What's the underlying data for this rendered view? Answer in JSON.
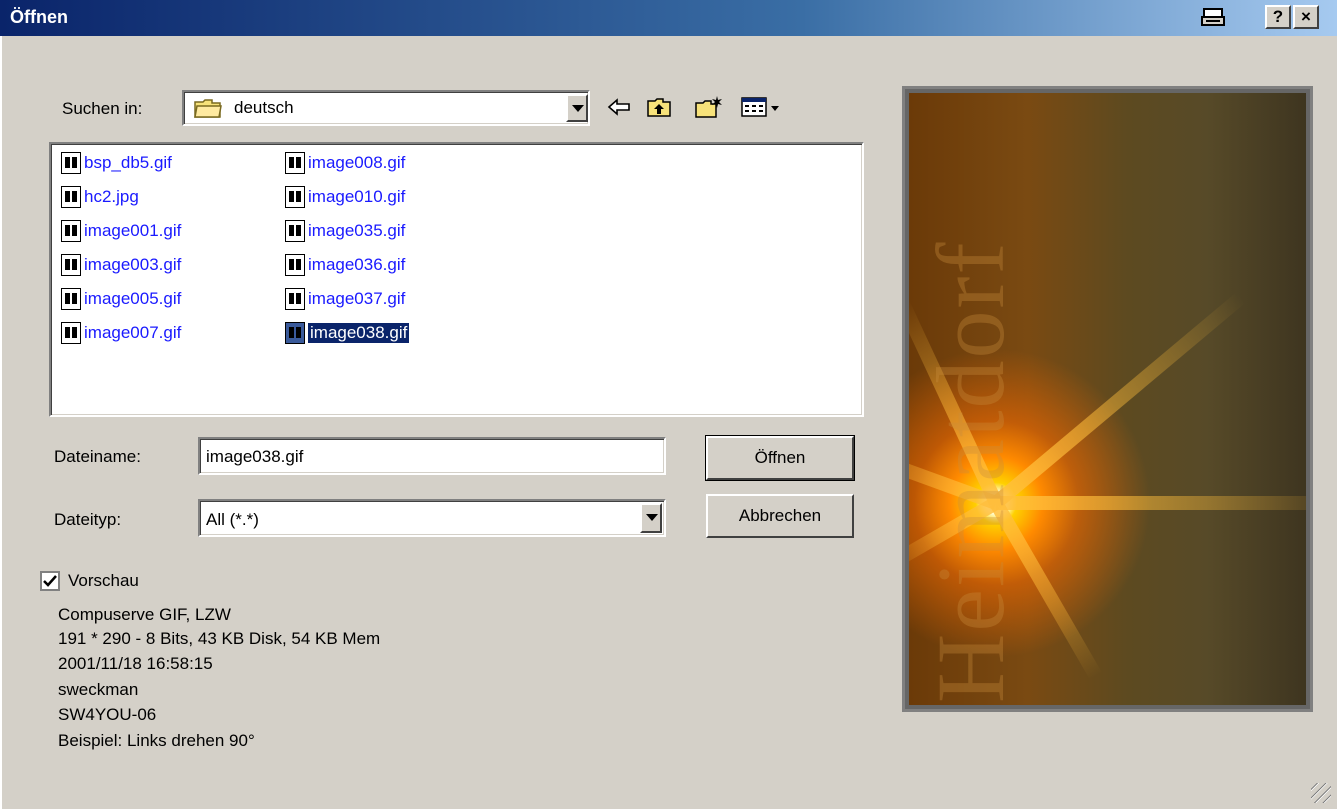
{
  "window": {
    "title": "Öffnen",
    "print_icon": "printer-icon",
    "help_label": "?",
    "close_label": "×"
  },
  "lookin": {
    "label": "Suchen in:",
    "value": "deutsch",
    "folder_icon": "folder-icon"
  },
  "toolbar": {
    "back_icon": "back-arrow-icon",
    "up_icon": "up-folder-icon",
    "newfolder_icon": "new-folder-icon",
    "view_icon": "view-menu-icon"
  },
  "files": {
    "col1": [
      "bsp_db5.gif",
      "hc2.jpg",
      "image001.gif",
      "image003.gif",
      "image005.gif",
      "image007.gif"
    ],
    "col2": [
      "image008.gif",
      "image010.gif",
      "image035.gif",
      "image036.gif",
      "image037.gif",
      "image038.gif"
    ],
    "selected": "image038.gif"
  },
  "filename": {
    "label": "Dateiname:",
    "value": "image038.gif"
  },
  "filetype": {
    "label": "Dateityp:",
    "value": "All (*.*)"
  },
  "buttons": {
    "open": "Öffnen",
    "cancel": "Abbrechen"
  },
  "preview": {
    "checkbox_label": "Vorschau",
    "checked": true,
    "info": [
      "Compuserve GIF, LZW",
      "191 * 290  -  8 Bits, 43 KB Disk, 54 KB Mem",
      "2001/11/18 16:58:15",
      "sweckman",
      "SW4YOU-06",
      "Beispiel: Links drehen 90°"
    ],
    "image_text": "Heimatdorf"
  },
  "colors": {
    "titlebar_start": "#0a246a",
    "titlebar_end": "#a6caf0",
    "dialog_bg": "#d4d0c8",
    "file_link": "#1a1aff",
    "selection": "#0a246a"
  }
}
